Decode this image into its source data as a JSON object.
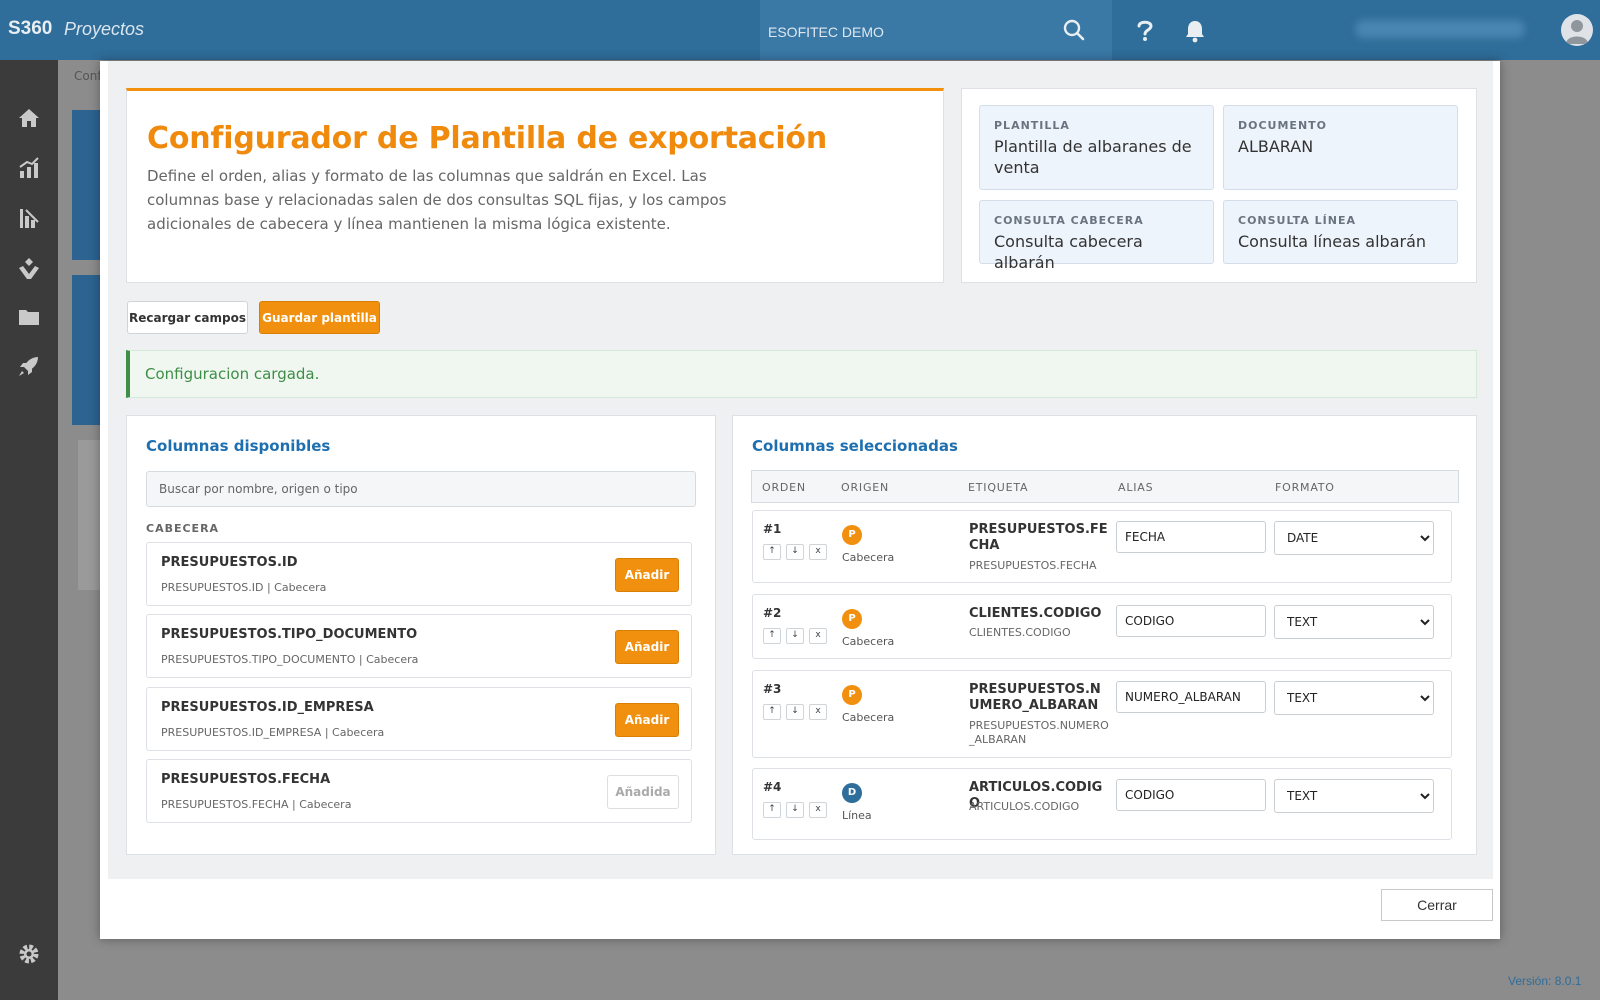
{
  "topbar": {
    "brand": "S360",
    "app_name": "Proyectos",
    "company": "ESOFITEC DEMO",
    "icons": [
      "search-icon",
      "help-icon",
      "bell-icon",
      "user-avatar-icon"
    ],
    "color": "#2f6d9a"
  },
  "sidebar": {
    "items": [
      "home-icon",
      "analytics-icon",
      "chart-icon",
      "hands-icon",
      "folder-icon",
      "rocket-icon"
    ],
    "footer_icon": "gear-icon"
  },
  "background": {
    "breadcrumb": "Conf"
  },
  "version": "Versión: 8.0.1",
  "hero": {
    "title": "Configurador de Plantilla de exportación",
    "description": "Define el orden, alias y formato de las columnas que saldrán en Excel. Las columnas base y relacionadas salen de dos consultas SQL fijas, y los campos adicionales de cabecera y línea mantienen la misma lógica existente."
  },
  "meta": {
    "plantilla": {
      "label": "PLANTILLA",
      "value": "Plantilla de albaranes de venta"
    },
    "documento": {
      "label": "DOCUMENTO",
      "value": "ALBARAN"
    },
    "consulta_cabecera": {
      "label": "CONSULTA CABECERA",
      "value": "Consulta cabecera albarán"
    },
    "consulta_linea": {
      "label": "CONSULTA LÍNEA",
      "value": "Consulta líneas albarán"
    }
  },
  "actions": {
    "reload": "Recargar campos",
    "save": "Guardar plantilla"
  },
  "alert": "Configuracion cargada.",
  "available": {
    "title": "Columnas disponibles",
    "search_placeholder": "Buscar por nombre, origen o tipo",
    "group": "CABECERA",
    "items": [
      {
        "name": "PRESUPUESTOS.ID",
        "sub": "PRESUPUESTOS.ID | Cabecera",
        "action": "Añadir"
      },
      {
        "name": "PRESUPUESTOS.TIPO_DOCUMENTO",
        "sub": "PRESUPUESTOS.TIPO_DOCUMENTO | Cabecera",
        "action": "Añadir"
      },
      {
        "name": "PRESUPUESTOS.ID_EMPRESA",
        "sub": "PRESUPUESTOS.ID_EMPRESA | Cabecera",
        "action": "Añadir"
      },
      {
        "name": "PRESUPUESTOS.FECHA",
        "sub": "PRESUPUESTOS.FECHA | Cabecera",
        "action": "Añadida"
      }
    ]
  },
  "selected": {
    "title": "Columnas seleccionadas",
    "headers": {
      "orden": "ORDEN",
      "origen": "ORIGEN",
      "etiqueta": "ETIQUETA",
      "alias": "ALIAS",
      "formato": "FORMATO"
    },
    "move_buttons": {
      "up": "↑",
      "down": "↓",
      "remove": "x"
    },
    "rows": [
      {
        "order": "#1",
        "badge": "P",
        "origin": "Cabecera",
        "label": "PRESUPUESTOS.FECHA",
        "sub": "PRESUPUESTOS.FECHA",
        "alias": "FECHA",
        "format": "DATE"
      },
      {
        "order": "#2",
        "badge": "P",
        "origin": "Cabecera",
        "label": "CLIENTES.CODIGO",
        "sub": "CLIENTES.CODIGO",
        "alias": "CODIGO",
        "format": "TEXT"
      },
      {
        "order": "#3",
        "badge": "P",
        "origin": "Cabecera",
        "label": "PRESUPUESTOS.NUMERO_ALBARAN",
        "sub": "PRESUPUESTOS.NUMERO_ALBARAN",
        "alias": "NUMERO_ALBARAN",
        "format": "TEXT"
      },
      {
        "order": "#4",
        "badge": "D",
        "origin": "Línea",
        "label": "ARTICULOS.CODIGO",
        "sub": "ARTICULOS.CODIGO",
        "alias": "CODIGO",
        "format": "TEXT"
      }
    ]
  },
  "footer": {
    "close": "Cerrar"
  },
  "colors": {
    "accent": "#f1900f",
    "title_blue": "#1e6fb0",
    "success": "#3e8e47"
  }
}
